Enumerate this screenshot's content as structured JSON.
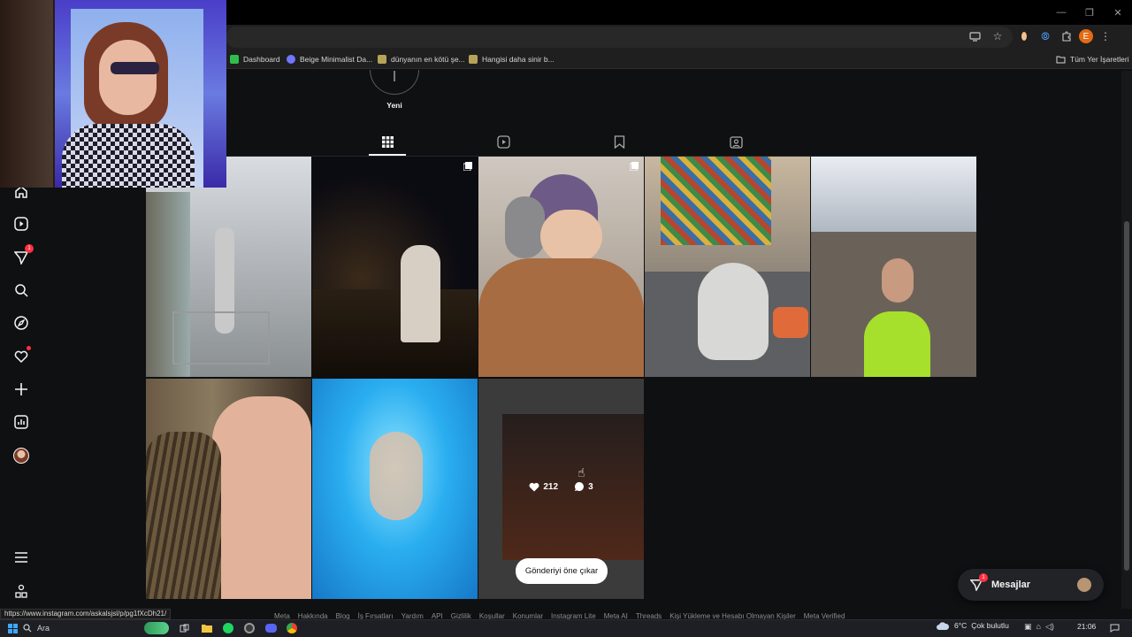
{
  "browser": {
    "bookmarks": [
      {
        "label": "Dashboard",
        "color": "#2fbe4b"
      },
      {
        "label": "Beige Minimalist Da...",
        "color": "#6f78ff"
      },
      {
        "label": "dünyanın en kötü şe...",
        "color": "#b6a35a"
      },
      {
        "label": "Hangisi daha sinir b...",
        "color": "#b6a35a"
      }
    ],
    "all_bookmarks": "Tüm Yer İşaretleri",
    "profile_initial": "E",
    "status_url": "https://www.instagram.com/askalsjsl/p/pg1fXcDh21/"
  },
  "profile": {
    "new_highlight_label": "Yeni",
    "tabs": [
      "posts-grid",
      "reels",
      "saved",
      "tagged"
    ],
    "active_tab": "posts-grid"
  },
  "sidebar": {
    "notification_badge": "1",
    "icons": [
      "home-icon",
      "reels-icon",
      "direct-icon",
      "search-icon",
      "explore-icon",
      "heart-icon",
      "create-icon",
      "insights-icon",
      "profile-avatar",
      "menu-icon",
      "meta-apps-icon"
    ]
  },
  "hover_post": {
    "likes": "212",
    "comments": "3",
    "pin_label": "Gönderiyi öne çıkar"
  },
  "messages": {
    "label": "Mesajlar",
    "badge": "1"
  },
  "footer_links": [
    "Meta",
    "Hakkında",
    "Blog",
    "İş Fırsatları",
    "Yardım",
    "API",
    "Gizlilik",
    "Koşullar",
    "Konumlar",
    "Instagram Lite",
    "Meta AI",
    "Threads",
    "Kişi Yükleme ve Hesabı Olmayan Kişiler",
    "Meta Verified"
  ],
  "taskbar": {
    "search_label": "Ara",
    "weather_temp": "6°C",
    "weather_desc": "Çok bulutlu",
    "time": "21:06"
  },
  "colors": {
    "accent_red": "#ff3040",
    "page_bg": "#0f1012"
  }
}
